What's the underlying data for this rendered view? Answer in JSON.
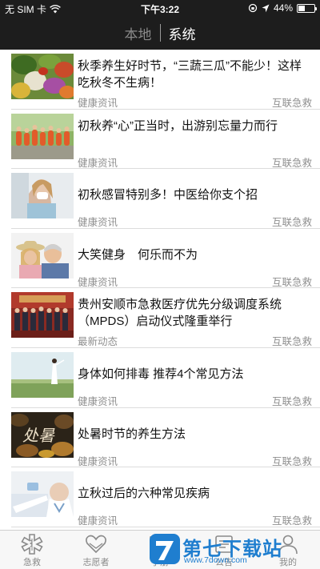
{
  "status_bar": {
    "carrier": "无 SIM 卡",
    "time": "下午3:22",
    "battery": "44%",
    "battery_level": 0.44
  },
  "header": {
    "tabs": [
      {
        "label": "本地",
        "active": false
      },
      {
        "label": "系统",
        "active": true
      }
    ]
  },
  "news": [
    {
      "title": "秋季养生好时节，“三蔬三瓜”不能少！这样吃秋冬不生病！",
      "category": "健康资讯",
      "source": "互联急救",
      "thumb": "vegetables"
    },
    {
      "title": "初秋养“心”正当时，出游别忘量力而行",
      "category": "健康资讯",
      "source": "互联急救",
      "thumb": "group-walk"
    },
    {
      "title": "初秋感冒特别多！中医给你支个招",
      "category": "健康资讯",
      "source": "互联急救",
      "thumb": "cold-woman"
    },
    {
      "title": "大笑健身　何乐而不为",
      "category": "健康资讯",
      "source": "互联急救",
      "thumb": "laughing-couple"
    },
    {
      "title": "贵州安顺市急救医疗优先分级调度系统（MPDS）启动仪式隆重举行",
      "category": "最新动态",
      "source": "互联急救",
      "thumb": "ceremony"
    },
    {
      "title": "身体如何排毒 推荐4个常见方法",
      "category": "健康资讯",
      "source": "互联急救",
      "thumb": "field-woman"
    },
    {
      "title": "处暑时节的养生方法",
      "category": "健康资讯",
      "source": "互联急救",
      "thumb": "chushu"
    },
    {
      "title": "立秋过后的六种常见疾病",
      "category": "健康资讯",
      "source": "互联急救",
      "thumb": "doctor"
    }
  ],
  "thumb_text": {
    "chushu": "处暑"
  },
  "tabbar": {
    "items": [
      {
        "label": "急救",
        "icon": "star-of-life-icon"
      },
      {
        "label": "志愿者",
        "icon": "heart-hands-icon"
      },
      {
        "label": "手册",
        "icon": "book-icon"
      },
      {
        "label": "公告",
        "icon": "announcement-icon"
      },
      {
        "label": "我的",
        "icon": "person-icon"
      }
    ]
  },
  "watermark": {
    "text": "第七下载站",
    "url": "www.7down.com"
  }
}
